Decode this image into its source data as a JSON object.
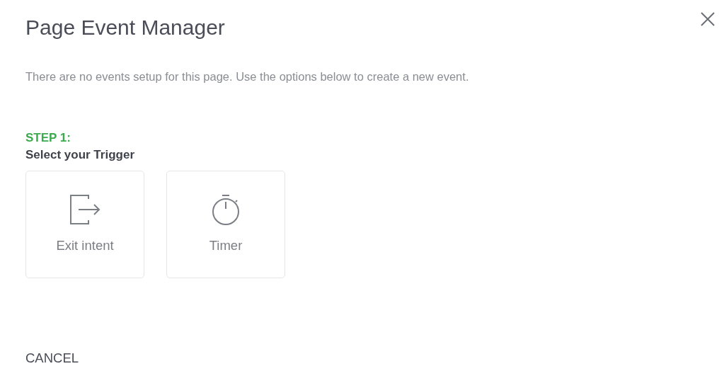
{
  "title": "Page Event Manager",
  "description": "There are no events setup for this page. Use the options below to create a new event.",
  "step": {
    "label": "STEP 1:",
    "heading": "Select your Trigger"
  },
  "triggers": [
    {
      "kind": "exit",
      "label": "Exit intent"
    },
    {
      "kind": "timer",
      "label": "Timer"
    }
  ],
  "cancel": "CANCEL"
}
